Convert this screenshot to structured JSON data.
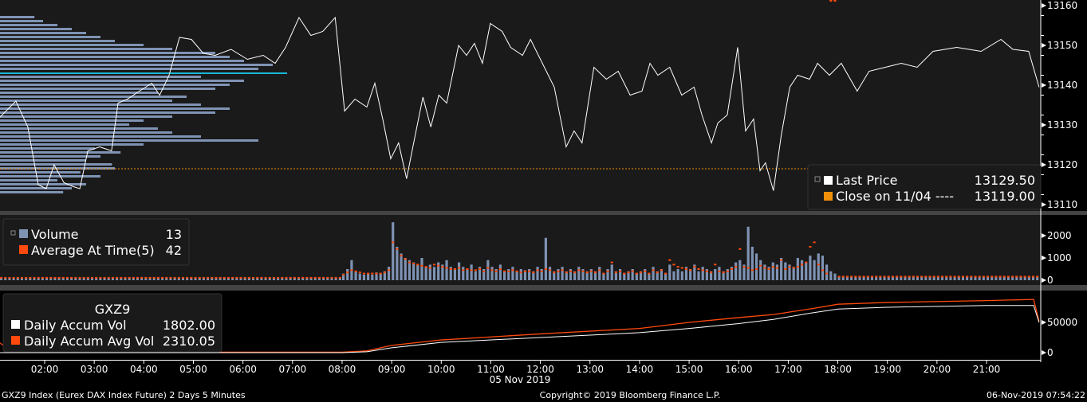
{
  "chart_data": [
    {
      "type": "line",
      "title": "GXZ9 Index (Eurex DAX Index Future) 2 Days 5 Minutes",
      "ylim": [
        13108,
        13162
      ],
      "yticks": [
        13110,
        13120,
        13130,
        13140,
        13150,
        13160
      ],
      "legend": [
        {
          "label": "Last Price",
          "value": "13129.50",
          "color": "#ffffff"
        },
        {
          "label": "Close on 11/04 ----",
          "value": "13119.00",
          "color": "#f0900a"
        }
      ],
      "close_prev": 13119,
      "price": {
        "t": [
          1.1,
          1.42,
          1.66,
          1.87,
          2.03,
          2.19,
          2.39,
          2.58,
          2.71,
          2.87,
          3.11,
          3.35,
          3.48,
          3.67,
          3.91,
          4.16,
          4.32,
          4.51,
          4.72,
          4.96,
          5.2,
          5.44,
          5.76,
          6.09,
          6.41,
          6.65,
          6.86,
          7.13,
          7.37,
          7.61,
          7.86,
          8.05,
          8.26,
          8.5,
          8.66,
          8.82,
          8.98,
          9.14,
          9.3,
          9.46,
          9.63,
          9.79,
          9.95,
          10.11,
          10.35,
          10.51,
          10.67,
          10.83,
          10.99,
          11.23,
          11.4,
          11.64,
          11.8,
          12.04,
          12.28,
          12.52,
          12.68,
          12.84,
          13.08,
          13.33,
          13.57,
          13.81,
          14.05,
          14.21,
          14.37,
          14.61,
          14.85,
          15.1,
          15.26,
          15.45,
          15.58,
          15.77,
          15.98,
          16.14,
          16.3,
          16.43,
          16.54,
          16.7,
          16.86,
          17.03,
          17.19,
          17.43,
          17.59,
          17.83,
          18.07,
          18.39,
          18.63,
          18.96,
          19.28,
          19.6,
          19.92,
          20.4,
          20.89,
          21.29,
          21.53,
          21.85,
          22.06
        ],
        "v": [
          13132,
          13136,
          13129.5,
          13115,
          13114,
          13120,
          13115.5,
          13114.5,
          13114,
          13123.5,
          13124.5,
          13123.5,
          13135.5,
          13136.5,
          13138.5,
          13140.5,
          13137.5,
          13142.5,
          13152,
          13151.5,
          13148,
          13147.5,
          13149,
          13146.5,
          13147.5,
          13145.5,
          13149.5,
          13157,
          13152.5,
          13153.5,
          13157,
          13133.5,
          13136.5,
          13134.5,
          13140.5,
          13131.5,
          13121.5,
          13125.5,
          13116.5,
          13126.5,
          13137,
          13129.5,
          13137.5,
          13135.5,
          13150,
          13147.5,
          13150.5,
          13145.5,
          13155.5,
          13153.5,
          13149.5,
          13147.5,
          13151.5,
          13145.5,
          13139.5,
          13124.5,
          13128.5,
          13125.5,
          13144.5,
          13141.5,
          13143.5,
          13137.5,
          13138.5,
          13145.5,
          13142.5,
          13144.5,
          13137.5,
          13139.5,
          13132.5,
          13125.5,
          13130.5,
          13132.5,
          13149.5,
          13128.5,
          13131.5,
          13118.5,
          13120.5,
          13113.5,
          13127.5,
          13139.5,
          13142.5,
          13141.5,
          13145.5,
          13142.5,
          13145.5,
          13138.5,
          13143.5,
          13144.5,
          13145.5,
          13144.5,
          13148.5,
          13149.5,
          13148.5,
          13151.5,
          13149,
          13148.5,
          13139.5
        ]
      },
      "volume_profile": {
        "from": 13113,
        "step": 1,
        "poc": 13143,
        "rel": [
          0.22,
          0.25,
          0.3,
          0.2,
          0.35,
          0.28,
          0.4,
          0.39,
          0.3,
          0.35,
          0.42,
          0.33,
          0.5,
          0.9,
          0.7,
          0.6,
          0.55,
          0.45,
          0.5,
          0.6,
          0.75,
          0.8,
          0.7,
          0.6,
          0.65,
          0.55,
          0.75,
          0.8,
          0.85,
          0.7,
          1.0,
          0.9,
          0.95,
          0.85,
          0.8,
          0.75,
          0.6,
          0.5,
          0.4,
          0.35,
          0.3,
          0.25,
          0.2,
          0.15,
          0.12
        ]
      }
    },
    {
      "type": "bar",
      "ylim": [
        -300,
        2800
      ],
      "yticks": [
        0,
        1000,
        2000
      ],
      "legend": [
        {
          "label": "Volume",
          "value": "13",
          "color": "#7f93b4"
        },
        {
          "label": "Average At Time(5)",
          "value": "42",
          "color": "#ff4a0d"
        }
      ],
      "pre_session_level": 110,
      "post_session_level": 160,
      "session_start": 8.0,
      "bar_minutes": 5,
      "volume": [
        300,
        500,
        900,
        400,
        300,
        250,
        300,
        250,
        350,
        300,
        400,
        600,
        2600,
        1500,
        1200,
        1000,
        900,
        800,
        700,
        1000,
        600,
        700,
        600,
        800,
        700,
        900,
        600,
        500,
        800,
        600,
        500,
        700,
        400,
        600,
        500,
        900,
        600,
        500,
        700,
        400,
        500,
        600,
        400,
        500,
        450,
        500,
        400,
        600,
        500,
        1900,
        600,
        400,
        500,
        600,
        400,
        500,
        400,
        600,
        500,
        400,
        500,
        400,
        600,
        300,
        500,
        700,
        400,
        500,
        300,
        400,
        500,
        300,
        400,
        500,
        300,
        600,
        400,
        500,
        300,
        700,
        400,
        500,
        400,
        600,
        500,
        700,
        400,
        600,
        500,
        400,
        500,
        600,
        400,
        500,
        600,
        800,
        900,
        700,
        2400,
        1500,
        1200,
        900,
        700,
        600,
        800,
        700,
        1000,
        800,
        700,
        600,
        1000,
        900,
        800,
        1100,
        900,
        1200,
        1100,
        700,
        400,
        300
      ],
      "avg": [
        250,
        350,
        450,
        400,
        350,
        300,
        300,
        300,
        300,
        300,
        350,
        450,
        1700,
        1400,
        1100,
        950,
        800,
        750,
        700,
        650,
        600,
        550,
        700,
        650,
        600,
        550,
        500,
        500,
        550,
        450,
        500,
        450,
        450,
        500,
        400,
        550,
        450,
        400,
        500,
        400,
        400,
        450,
        400,
        350,
        400,
        400,
        350,
        450,
        400,
        500,
        450,
        350,
        400,
        450,
        350,
        400,
        350,
        450,
        400,
        350,
        400,
        350,
        450,
        300,
        400,
        800,
        350,
        400,
        300,
        350,
        400,
        300,
        350,
        400,
        300,
        450,
        350,
        450,
        300,
        900,
        700,
        600,
        550,
        500,
        450,
        600,
        500,
        450,
        400,
        350,
        700,
        400,
        350,
        400,
        500,
        600,
        1400,
        600,
        550,
        450,
        500,
        650,
        550,
        500,
        600,
        550,
        900,
        500,
        600,
        550,
        600,
        700,
        800,
        1500,
        1700,
        700,
        450,
        300
      ]
    },
    {
      "type": "line",
      "ylim": [
        -10000,
        95000
      ],
      "yticks": [
        0,
        50000
      ],
      "title": "GXZ9",
      "legend": [
        {
          "label": "Daily Accum Vol",
          "value": "1802.00",
          "color": "#ffffff"
        },
        {
          "label": "Daily Accum Avg Vol",
          "value": "2310.05",
          "color": "#ff4a0d"
        }
      ],
      "accum": {
        "t": [
          1.1,
          1.35,
          8.0,
          8.5,
          9.0,
          10.0,
          12.0,
          14.0,
          15.0,
          16.0,
          16.7,
          17.5,
          18.0,
          19.0,
          21.0,
          21.95,
          22.06
        ],
        "vol": [
          0,
          0,
          0,
          1500,
          8000,
          17000,
          25000,
          33000,
          40000,
          48000,
          55000,
          66000,
          72000,
          75000,
          78000,
          78000,
          50000
        ],
        "avg": [
          16000,
          800,
          800,
          3000,
          12000,
          21000,
          31000,
          40000,
          50000,
          58000,
          63000,
          73000,
          80000,
          83000,
          86000,
          88000,
          52000
        ]
      }
    }
  ],
  "xaxis": {
    "ticks": [
      "02:00",
      "03:00",
      "04:00",
      "05:00",
      "06:00",
      "07:00",
      "08:00",
      "09:00",
      "10:00",
      "11:00",
      "12:00",
      "13:00",
      "14:00",
      "15:00",
      "16:00",
      "17:00",
      "18:00",
      "19:00",
      "20:00",
      "21:00"
    ],
    "date": "05 Nov 2019"
  },
  "footer": {
    "left": "GXZ9 Index (Eurex DAX Index Future) 2 Days 5 Minutes",
    "center": "Copyright© 2019 Bloomberg Finance L.P.",
    "right": "06-Nov-2019 07:54:22"
  }
}
